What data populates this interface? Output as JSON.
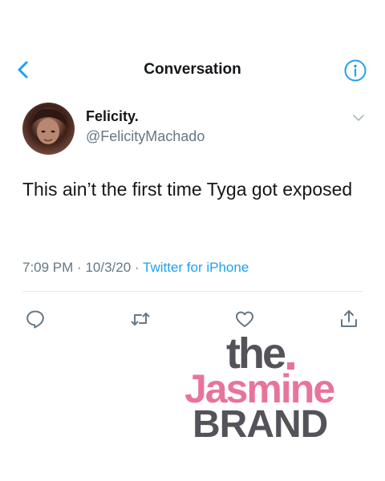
{
  "header": {
    "title": "Conversation",
    "back_icon": "chevron-left-icon",
    "info_icon": "info-circle-icon",
    "accent_color": "#1da1f2"
  },
  "tweet": {
    "author_name": "Felicity.",
    "author_handle": "@FelicityMachado",
    "text": "This ain’t the first time Tyga got exposed",
    "time": "7:09 PM",
    "date": "10/3/20",
    "separator": "·",
    "source": "Twitter for iPhone"
  },
  "actions": [
    {
      "icon": "reply-icon"
    },
    {
      "icon": "retweet-icon"
    },
    {
      "icon": "like-icon"
    },
    {
      "icon": "share-icon"
    }
  ],
  "watermark": {
    "line1": "the",
    "line2": "Jasmine",
    "line3": "BRAND",
    "pink": "#e8749b",
    "gray": "#54535a"
  }
}
